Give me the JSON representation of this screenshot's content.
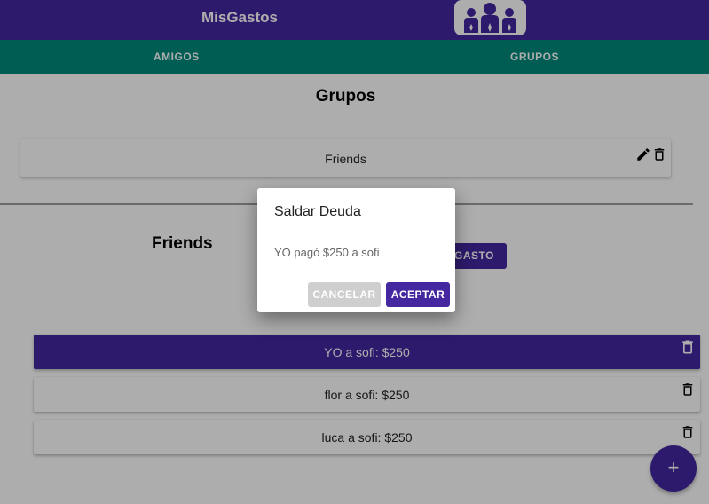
{
  "app": {
    "title": "MisGastos"
  },
  "tabs": [
    {
      "label": "AMIGOS"
    },
    {
      "label": "GRUPOS"
    }
  ],
  "groups_section": {
    "heading": "Grupos",
    "groups": [
      {
        "name": "Friends"
      }
    ]
  },
  "group_detail": {
    "heading": "Friends",
    "add_gasto_label": "GASTO",
    "debts": [
      {
        "label": "YO a sofi: $250",
        "selected": true
      },
      {
        "label": "flor a sofi: $250",
        "selected": false
      },
      {
        "label": "luca a sofi: $250",
        "selected": false
      }
    ]
  },
  "fab": {
    "label": "+"
  },
  "dialog": {
    "title": "Saldar Deuda",
    "message": "YO pagó $250 a sofi",
    "cancel_label": "CANCELAR",
    "accept_label": "ACEPTAR"
  },
  "colors": {
    "primary": "#4527a0",
    "tabs": "#00897b",
    "overlay": "rgba(0,0,0,0.32)"
  }
}
